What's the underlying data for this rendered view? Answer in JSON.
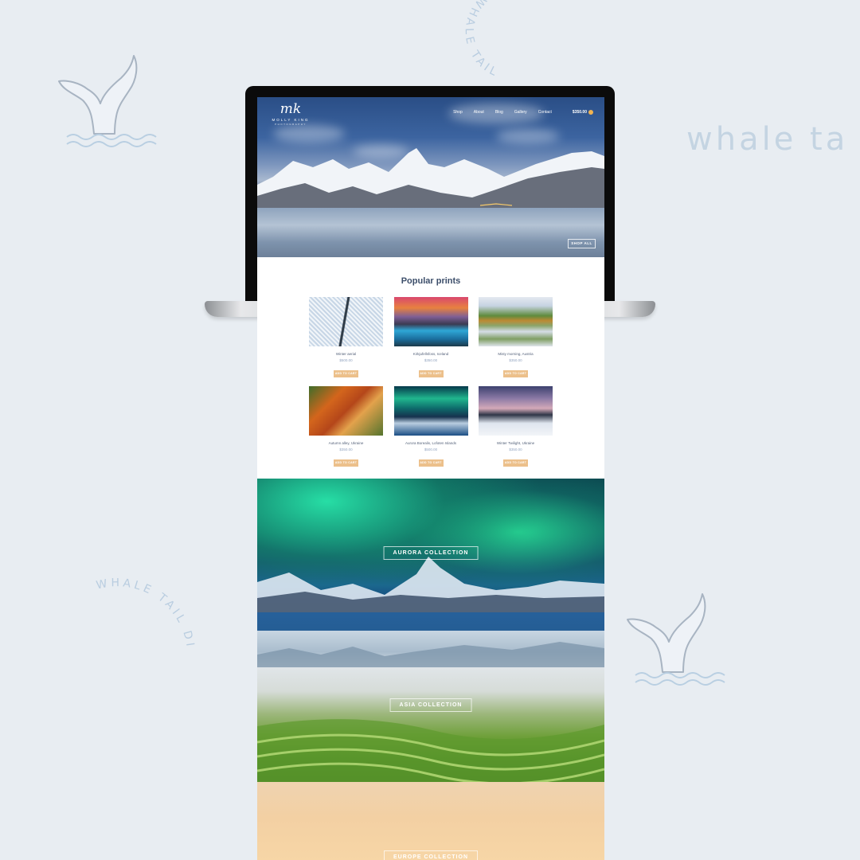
{
  "branding": {
    "curved_top": "WHALE TAIL",
    "curved_left": "WHALE TAIL DIGITAL",
    "large_text": "whale ta",
    "colors": {
      "background": "#e8edf2",
      "brand_text": "#c4d4e2",
      "whale_stroke": "#a8b4c2",
      "waves": "#b9cfe2"
    }
  },
  "site": {
    "logo": {
      "mark": "mk",
      "name": "MOLLY KING",
      "subtitle": "PHOTOGRAPHY"
    },
    "nav": {
      "items": [
        "Shop",
        "About",
        "Blog",
        "Gallery",
        "Contact"
      ],
      "cart_total": "$350.00",
      "cart_icon": "cart-icon"
    },
    "hero": {
      "button_label": "SHOP ALL"
    },
    "popular": {
      "title": "Popular prints",
      "products": [
        {
          "name": "Winter aerial",
          "price": "$500.00",
          "button": "ADD TO CART"
        },
        {
          "name": "Kirkjufellsfoss, Iceland",
          "price": "$350.00",
          "button": "ADD TO CART"
        },
        {
          "name": "Misty morning, Austria",
          "price": "$350.00",
          "button": "ADD TO CART"
        },
        {
          "name": "Autumn alley, Ukraine",
          "price": "$350.00",
          "button": "ADD TO CART"
        },
        {
          "name": "Aurora Borealis, Lofoten Islands",
          "price": "$500.00",
          "button": "ADD TO CART"
        },
        {
          "name": "Winter Twilight, Ukraine",
          "price": "$350.00",
          "button": "ADD TO CART"
        }
      ]
    },
    "collections": [
      {
        "label": "AURORA COLLECTION"
      },
      {
        "label": "ASIA COLLECTION"
      },
      {
        "label": "EUROPE COLLECTION"
      }
    ],
    "colors": {
      "accent_button": "#ecc08b",
      "heading": "#3c4e6a",
      "price": "#93a5c0"
    }
  }
}
